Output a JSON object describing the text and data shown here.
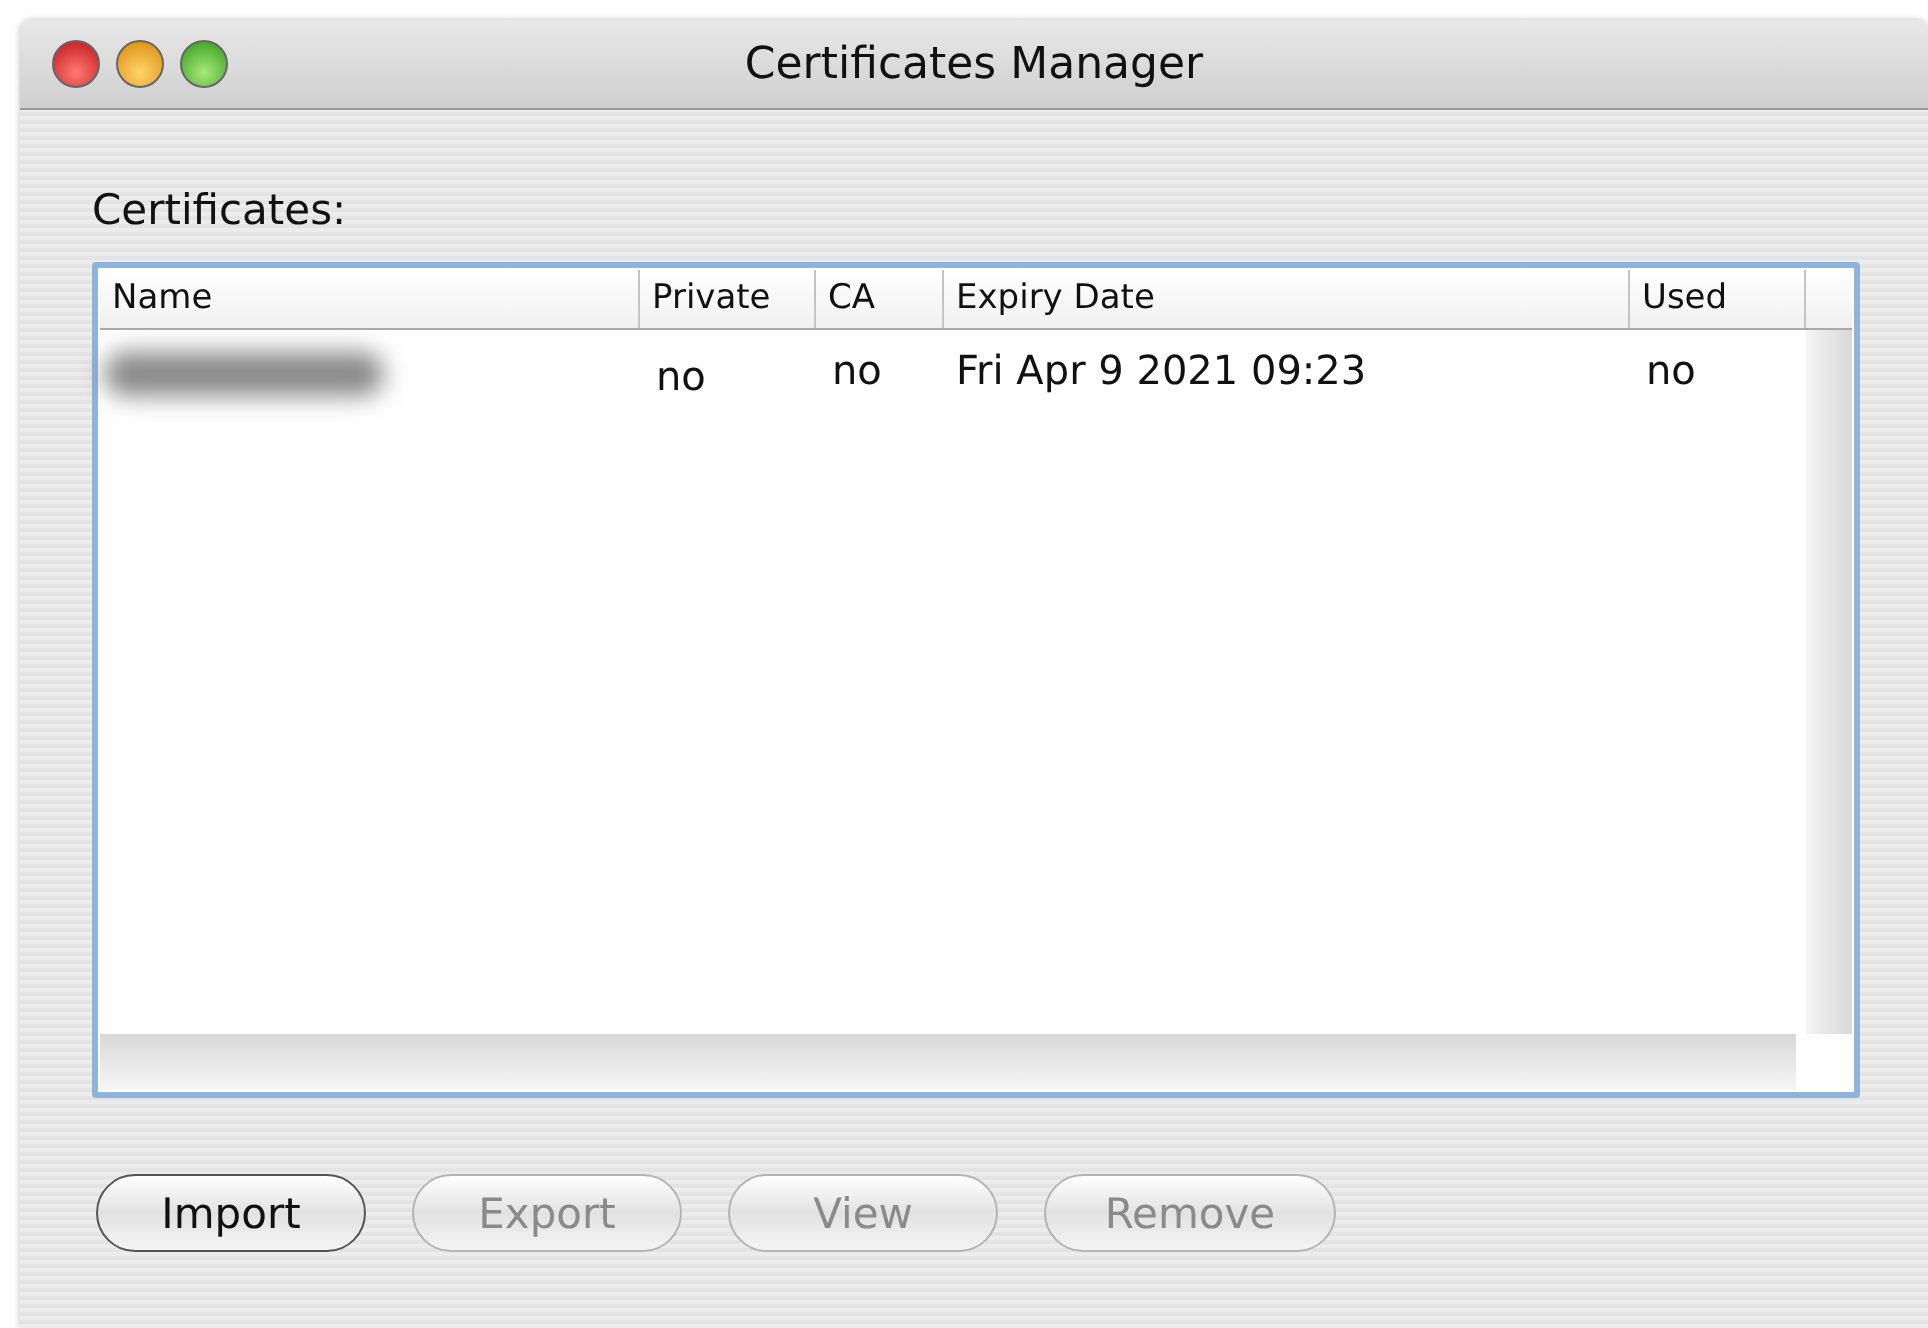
{
  "window": {
    "title": "Certificates Manager"
  },
  "list_label": "Certificates:",
  "table": {
    "columns": [
      "Name",
      "Private",
      "CA",
      "Expiry Date",
      "Used"
    ],
    "rows": [
      {
        "name_blurred": true,
        "cells": [
          "",
          "no",
          "no",
          "Fri Apr 9 2021 09:23",
          "no"
        ]
      }
    ]
  },
  "buttons": [
    {
      "label": "Import",
      "disabled": false
    },
    {
      "label": "Export",
      "disabled": true
    },
    {
      "label": "View",
      "disabled": true
    },
    {
      "label": "Remove",
      "disabled": true
    }
  ]
}
